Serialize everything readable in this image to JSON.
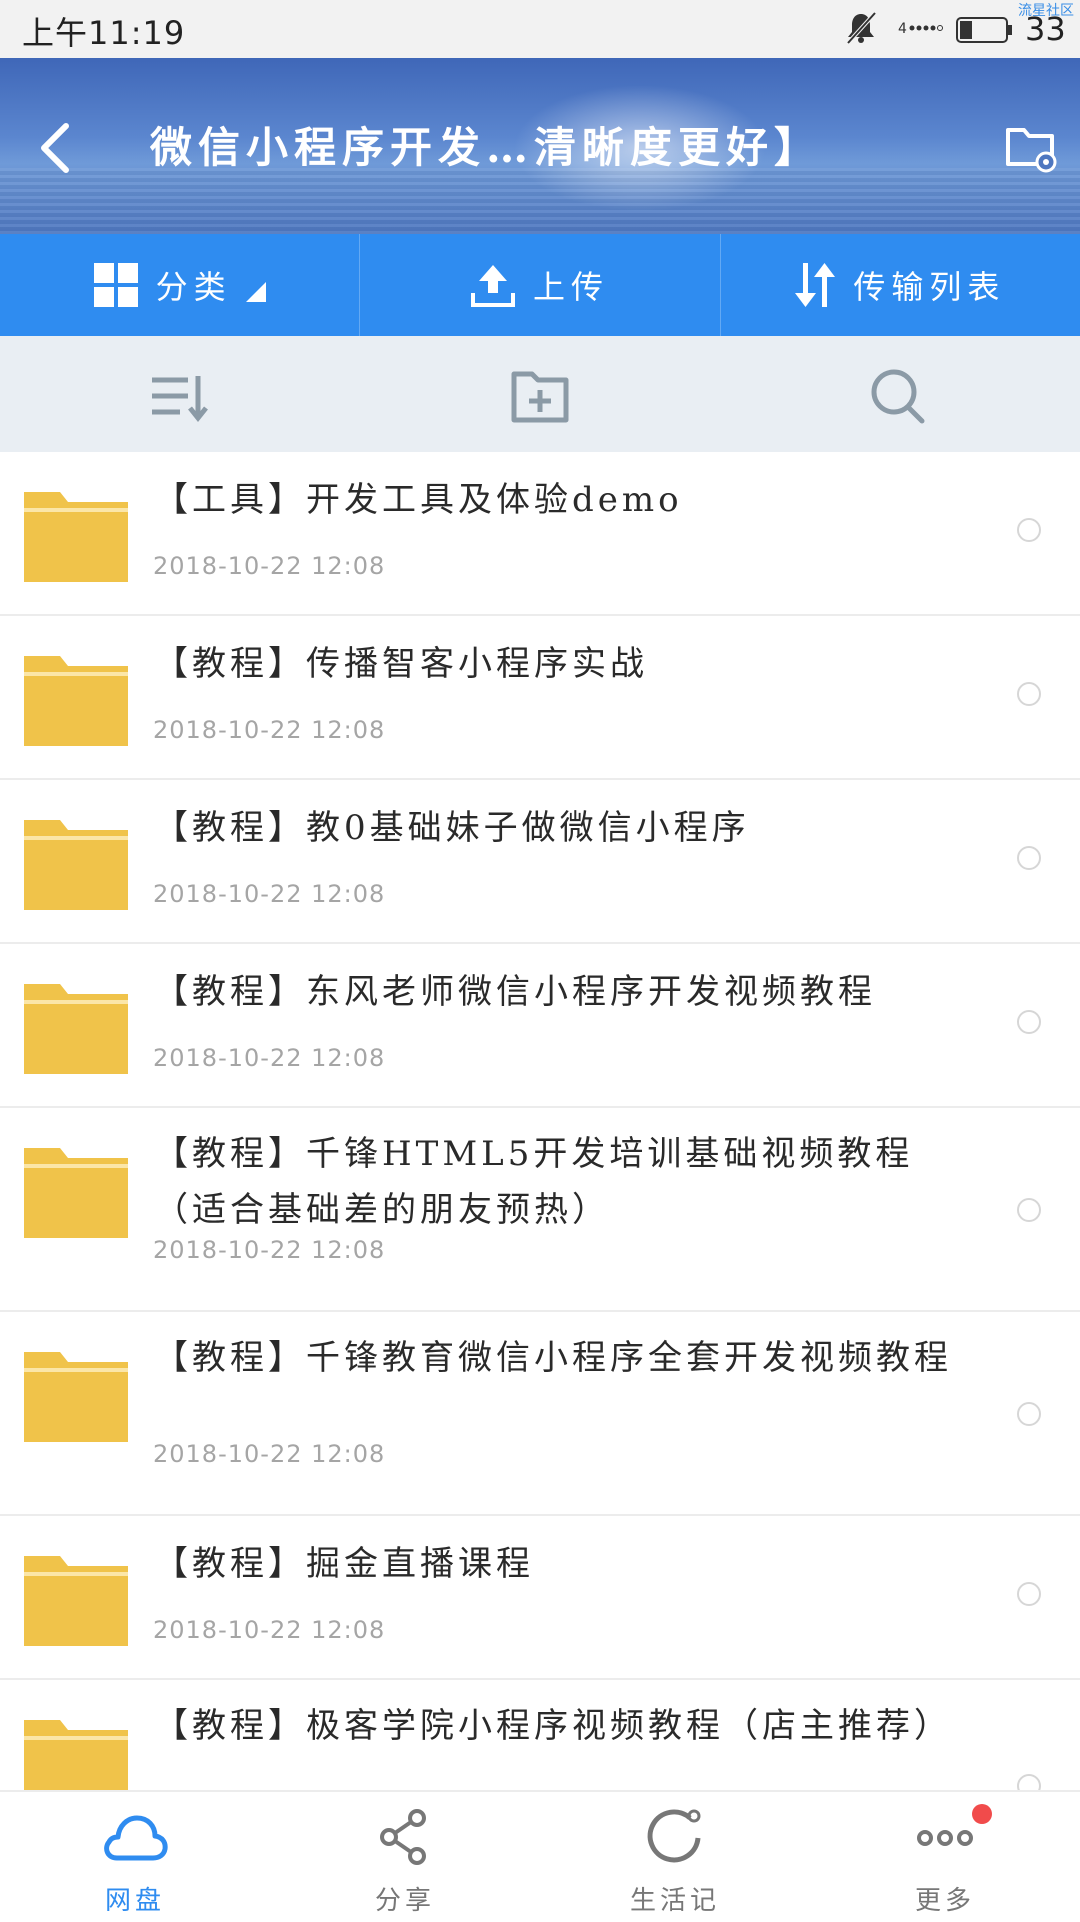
{
  "status_bar": {
    "time": "上午11:19",
    "battery": "33",
    "watermark": "流星社区"
  },
  "header": {
    "title": "微信小程序开发…清晰度更好】"
  },
  "tool_tabs": [
    {
      "label": "分类",
      "icon": "grid-icon"
    },
    {
      "label": "上传",
      "icon": "upload-icon"
    },
    {
      "label": "传输列表",
      "icon": "transfer-icon"
    }
  ],
  "action_bar": {
    "icons": [
      "sort-icon",
      "new-folder-icon",
      "search-icon"
    ]
  },
  "files": [
    {
      "name": "【工具】开发工具及体验demo",
      "date": "2018-10-22  12:08"
    },
    {
      "name": "【教程】传播智客小程序实战",
      "date": "2018-10-22  12:08"
    },
    {
      "name": "【教程】教0基础妹子做微信小程序",
      "date": "2018-10-22  12:08"
    },
    {
      "name": "【教程】东风老师微信小程序开发视频教程",
      "date": "2018-10-22  12:08"
    },
    {
      "name": "【教程】千锋HTML5开发培训基础视频教程（适合基础差的朋友预热）",
      "date": "2018-10-22  12:08"
    },
    {
      "name": "【教程】千锋教育微信小程序全套开发视频教程",
      "date": "2018-10-22  12:08"
    },
    {
      "name": "【教程】掘金直播课程",
      "date": "2018-10-22  12:08"
    },
    {
      "name": "【教程】极客学院小程序视频教程（店主推荐）",
      "date": ""
    }
  ],
  "bottom_nav": [
    {
      "label": "网盘",
      "icon": "cloud-icon",
      "active": true
    },
    {
      "label": "分享",
      "icon": "share-icon",
      "active": false
    },
    {
      "label": "生活记",
      "icon": "refresh-icon",
      "active": false
    },
    {
      "label": "更多",
      "icon": "more-icon",
      "active": false
    }
  ],
  "colors": {
    "accent": "#2f8cf0",
    "folder": "#f0c34a",
    "badge": "#f14b4b"
  }
}
